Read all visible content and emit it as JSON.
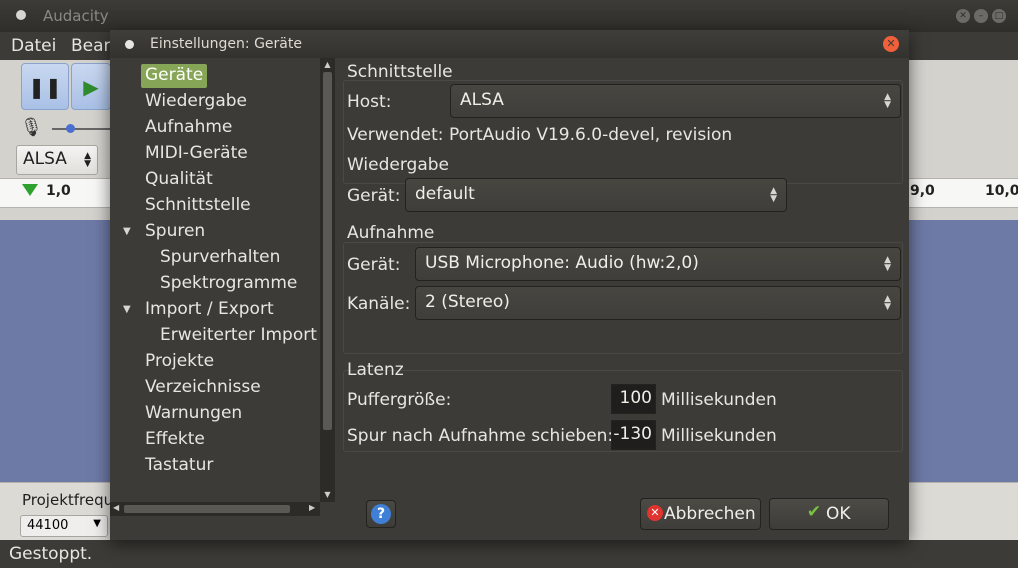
{
  "main_window": {
    "title": "Audacity",
    "menu": [
      "Datei",
      "Bear"
    ],
    "host_combo": "ALSA",
    "ruler_ticks": [
      "1,0",
      "9,0",
      "10,0"
    ],
    "project_rate_label": "Projektfrequ",
    "project_rate_value": "44100",
    "status": "Gestoppt."
  },
  "dialog": {
    "title": "Einstellungen: Geräte",
    "tree": [
      {
        "label": "Geräte",
        "level": 0,
        "selected": true
      },
      {
        "label": "Wiedergabe",
        "level": 0
      },
      {
        "label": "Aufnahme",
        "level": 0
      },
      {
        "label": "MIDI-Geräte",
        "level": 0
      },
      {
        "label": "Qualität",
        "level": 0
      },
      {
        "label": "Schnittstelle",
        "level": 0
      },
      {
        "label": "Spuren",
        "level": 0,
        "expanded": true
      },
      {
        "label": "Spurverhalten",
        "level": 1
      },
      {
        "label": "Spektrogramme",
        "level": 1
      },
      {
        "label": "Import / Export",
        "level": 0,
        "expanded": true
      },
      {
        "label": "Erweiterter Import",
        "level": 1
      },
      {
        "label": "Projekte",
        "level": 0
      },
      {
        "label": "Verzeichnisse",
        "level": 0
      },
      {
        "label": "Warnungen",
        "level": 0
      },
      {
        "label": "Effekte",
        "level": 0
      },
      {
        "label": "Tastatur",
        "level": 0
      }
    ],
    "interface": {
      "title": "Schnittstelle",
      "host_label": "Host:",
      "host_value": "ALSA",
      "using_text": "Verwendet: PortAudio V19.6.0-devel, revision"
    },
    "playback": {
      "title": "Wiedergabe",
      "device_label": "Gerät:",
      "device_value": "default"
    },
    "recording": {
      "title": "Aufnahme",
      "device_label": "Gerät:",
      "device_value": "USB Microphone: Audio (hw:2,0)",
      "channels_label": "Kanäle:",
      "channels_value": "2 (Stereo)"
    },
    "latency": {
      "title": "Latenz",
      "buffer_label": "Puffergröße:",
      "buffer_value": "100",
      "buffer_unit": "Millisekunden",
      "shift_label": "Spur nach Aufnahme schieben:",
      "shift_value": "-130",
      "shift_unit": "Millisekunden"
    },
    "buttons": {
      "help": "?",
      "cancel": "Abbrechen",
      "ok": "OK"
    }
  },
  "colors": {
    "selection_accent": "#87a556",
    "close_button": "#f0603a",
    "help_icon": "#3f7fd6",
    "cancel_icon": "#e0342f",
    "ok_check": "#7bc043"
  }
}
